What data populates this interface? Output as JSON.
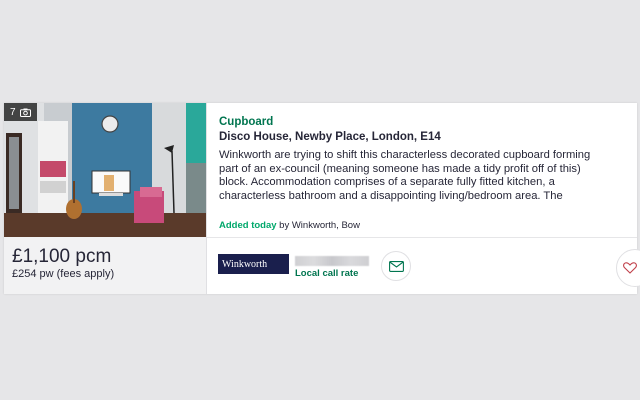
{
  "listing": {
    "photo_count": "7",
    "title": "Cupboard",
    "address": "Disco House, Newby Place, London, E14",
    "description": "Winkworth are trying to shift this characterless decorated cupboard forming part of an ex-council (meaning someone has made a tidy profit off of this) block. Accommodation comprises of a separate fully fitted kitchen, a characterless bathroom and a disappointing living/bedroom area. The",
    "price": "£1,100 pcm",
    "price_weekly": "£254 pw (fees apply)",
    "added_label": "Added today",
    "added_by": " by Winkworth, Bow",
    "agent_logo_text": "Winkworth",
    "call_rate": "Local call rate"
  },
  "icons": {
    "camera": "camera-icon",
    "email": "envelope-icon",
    "favourite": "heart-icon"
  },
  "colors": {
    "accent_green": "#00754f",
    "added_green": "#00a86b",
    "text": "#262637",
    "agent_navy": "#1a1f4d"
  }
}
